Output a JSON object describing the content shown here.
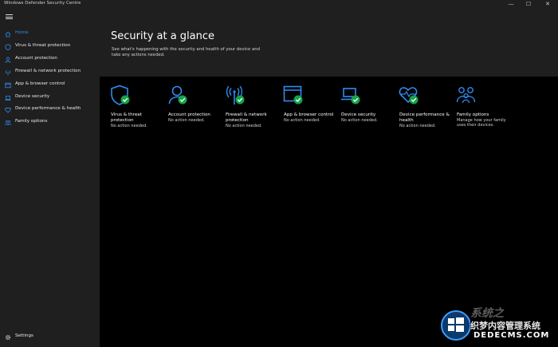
{
  "window": {
    "title": "Windows Defender Security Centre"
  },
  "controls": {
    "minimize": "—",
    "maximize": "☐",
    "close": "✕"
  },
  "colors": {
    "accent": "#2d8cf0",
    "check": "#16a34a",
    "sidebar_bg": "#1f1f1f",
    "content_bg": "#000000"
  },
  "sidebar": {
    "items": [
      {
        "label": "Home",
        "icon": "home-icon"
      },
      {
        "label": "Virus & threat protection",
        "icon": "shield-icon"
      },
      {
        "label": "Account protection",
        "icon": "person-icon"
      },
      {
        "label": "Firewall & network protection",
        "icon": "antenna-icon"
      },
      {
        "label": "App & browser control",
        "icon": "browser-window-icon"
      },
      {
        "label": "Device security",
        "icon": "laptop-icon"
      },
      {
        "label": "Device performance & health",
        "icon": "heart-icon"
      },
      {
        "label": "Family options",
        "icon": "family-icon"
      }
    ],
    "settings_label": "Settings"
  },
  "header": {
    "title": "Security at a glance",
    "subtitle": "See what's happening with the security and health of your device and take any actions needed."
  },
  "tiles": [
    {
      "title": "Virus & threat protection",
      "status": "No action needed.",
      "icon": "shield-icon"
    },
    {
      "title": "Account protection",
      "status": "No action needed.",
      "icon": "person-icon"
    },
    {
      "title": "Firewall & network protection",
      "status": "No action needed.",
      "icon": "antenna-icon"
    },
    {
      "title": "App & browser control",
      "status": "No action needed.",
      "icon": "browser-window-icon"
    },
    {
      "title": "Device security",
      "status": "No action needed.",
      "icon": "laptop-icon"
    },
    {
      "title": "Device performance & health",
      "status": "No action needed.",
      "icon": "heart-icon"
    },
    {
      "title": "Family options",
      "status": "Manage how your family uses their devices.",
      "icon": "family-icon"
    }
  ],
  "watermark": {
    "big": "系统之",
    "cn": "织梦内容管理系统",
    "en": "DEDECMS.COM"
  }
}
